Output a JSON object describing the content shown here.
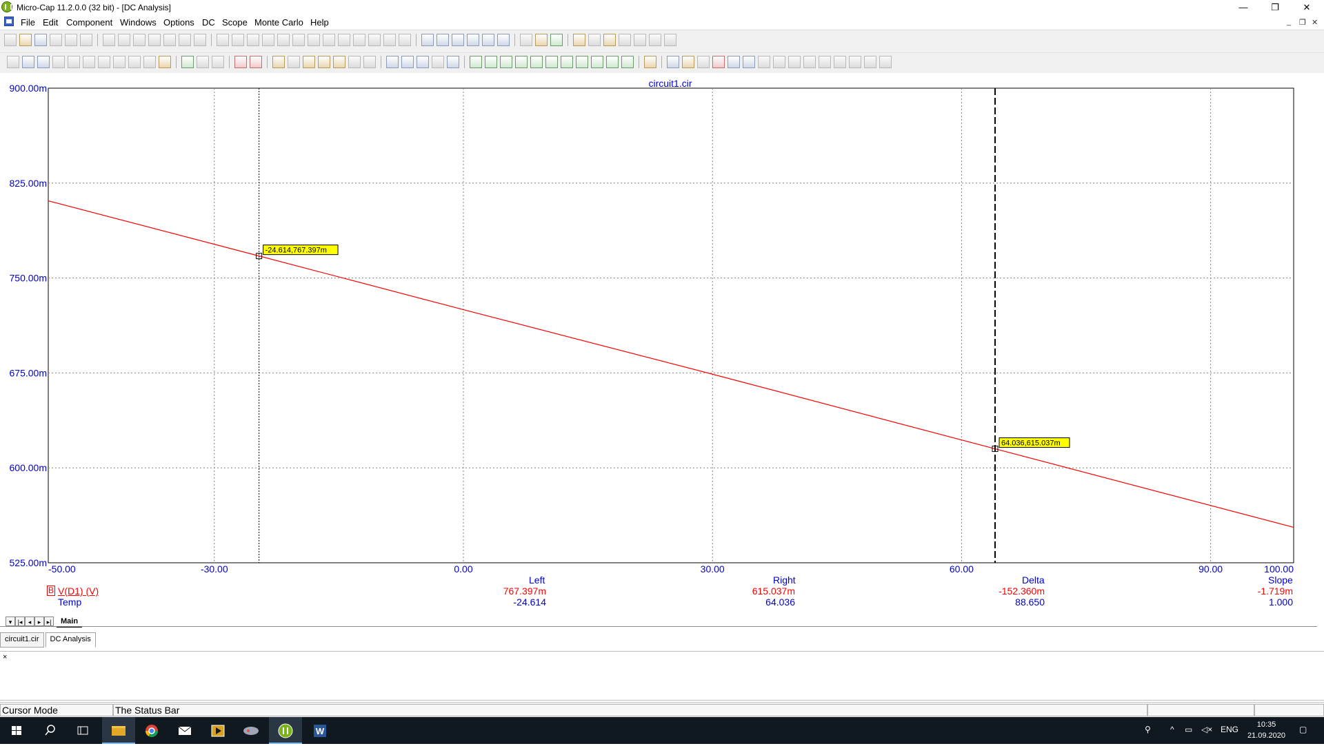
{
  "window": {
    "title": "Micro-Cap 11.2.0.0 (32 bit) - [DC Analysis]",
    "controls": {
      "minimize": "—",
      "maximize": "❐",
      "close": "✕"
    },
    "mdi_controls": {
      "minimize": "_",
      "restore": "❐",
      "close": "✕"
    }
  },
  "menu": [
    "File",
    "Edit",
    "Component",
    "Windows",
    "Options",
    "DC",
    "Scope",
    "Monte Carlo",
    "Help"
  ],
  "plot": {
    "title": "circuit1.cir",
    "colors": {
      "trace": "#ff0000",
      "axis_text": "#0000cc",
      "grid": "#808080"
    }
  },
  "chart_data": {
    "type": "line",
    "title": "circuit1.cir",
    "xlim": [
      -50,
      100
    ],
    "ylim": [
      0.525,
      0.9
    ],
    "x_ticks": [
      "-50.00",
      "-30.00",
      "0.00",
      "30.00",
      "60.00",
      "90.00",
      "100.00"
    ],
    "x_tick_values": [
      -50,
      -30,
      0,
      30,
      60,
      90,
      100
    ],
    "y_ticks": [
      "900.00m",
      "825.00m",
      "750.00m",
      "675.00m",
      "600.00m",
      "525.00m"
    ],
    "y_tick_values": [
      0.9,
      0.825,
      0.75,
      0.675,
      0.6,
      0.525
    ],
    "grid": true,
    "series": [
      {
        "name": "V(D1) (V)",
        "color": "#ff0000",
        "x": [
          -50,
          -24.614,
          0,
          30,
          64.036,
          100
        ],
        "y": [
          0.811,
          0.767397,
          0.725,
          0.674,
          0.615037,
          0.553
        ]
      }
    ],
    "xlabel": "Temp",
    "ylabel": "V(D1) (V)"
  },
  "cursors": {
    "left": {
      "x": -24.614,
      "y": 0.767397,
      "label": "-24.614,767.397m"
    },
    "right": {
      "x": 64.036,
      "y": 0.615037,
      "label": "64.036,615.037m"
    }
  },
  "readouts": {
    "series_marker": "B",
    "series_label": "V(D1) (V)",
    "x_label": "Temp",
    "headers": {
      "left": "Left",
      "right": "Right",
      "delta": "Delta",
      "slope": "Slope"
    },
    "y_values": {
      "left": "767.397m",
      "right": "615.037m",
      "delta": "-152.360m",
      "slope": "-1.719m"
    },
    "x_values": {
      "left": "-24.614",
      "right": "64.036",
      "delta": "88.650",
      "slope": "1.000"
    }
  },
  "page_tab": "Main",
  "doc_tabs": [
    "circuit1.cir",
    "DC Analysis"
  ],
  "output_close": "×",
  "status": {
    "mode": "Cursor Mode",
    "message": "The Status Bar"
  },
  "taskbar": {
    "lang": "ENG",
    "time": "10:35",
    "date": "21.09.2020"
  }
}
